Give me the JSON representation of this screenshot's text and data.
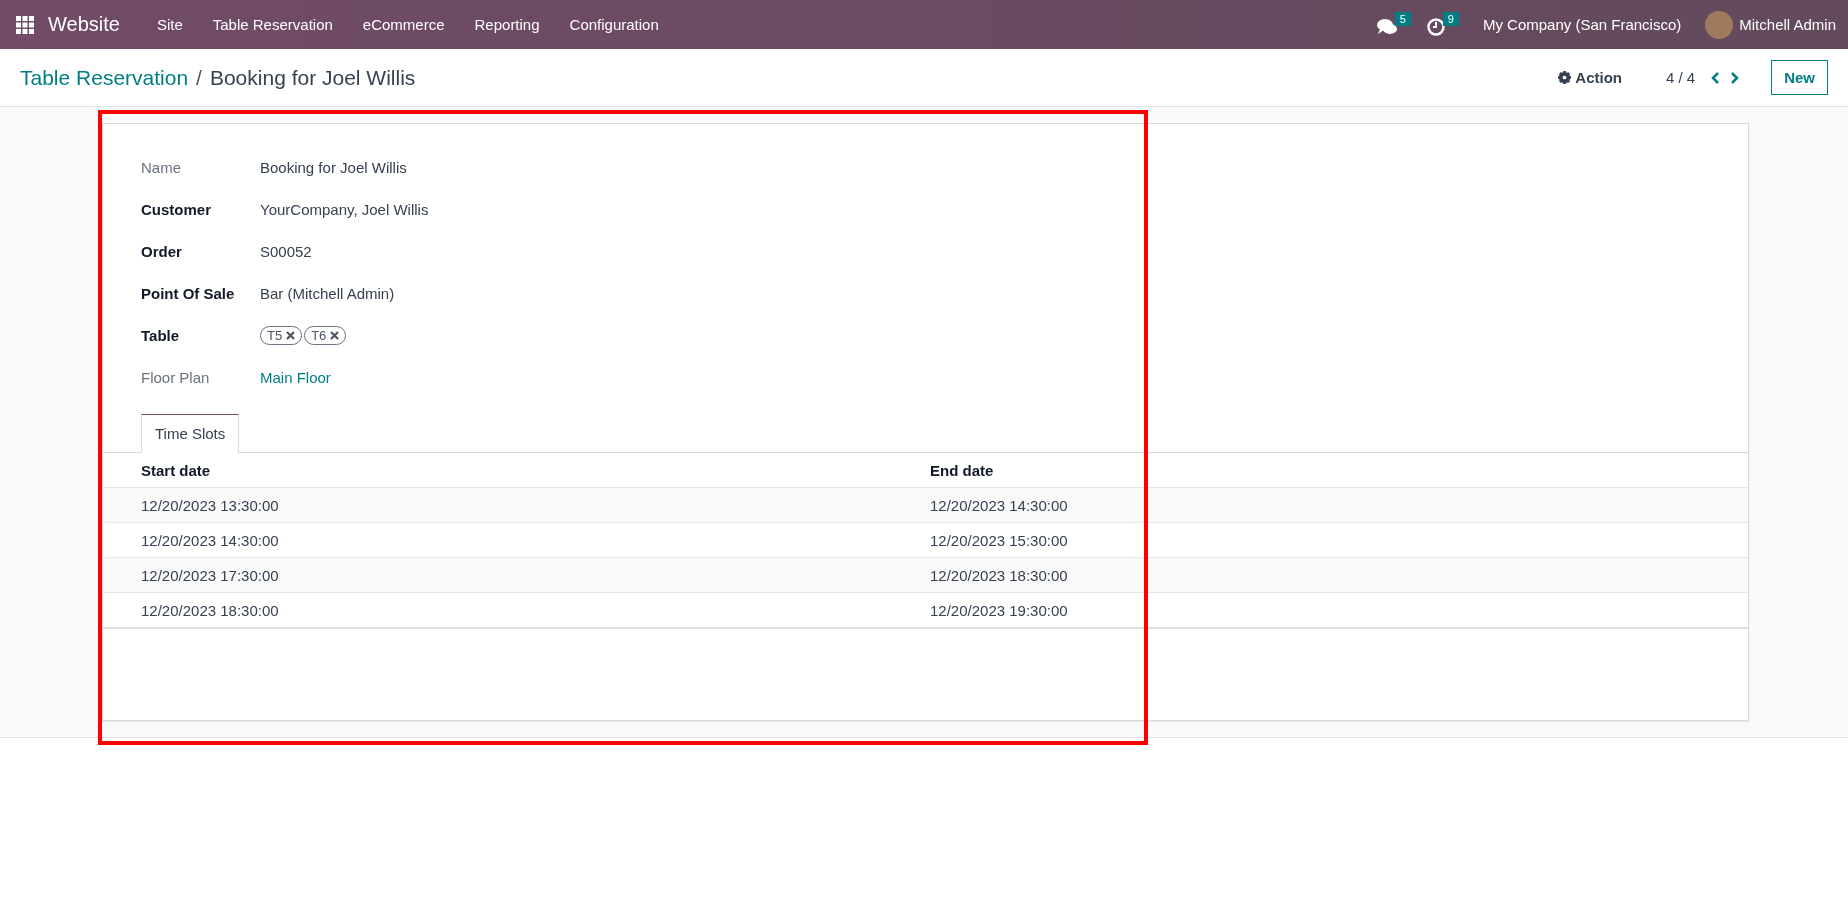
{
  "navbar": {
    "app_name": "Website",
    "menu": [
      "Site",
      "Table Reservation",
      "eCommerce",
      "Reporting",
      "Configuration"
    ],
    "messages_badge": "5",
    "activities_badge": "9",
    "company": "My Company (San Francisco)",
    "user": "Mitchell Admin"
  },
  "breadcrumb": {
    "parent": "Table Reservation",
    "separator": "/",
    "current": "Booking for Joel Willis"
  },
  "control_panel": {
    "action": "Action",
    "pager": "4 / 4",
    "new_button": "New"
  },
  "fields": [
    {
      "label": "Name",
      "kind": "text",
      "required": false,
      "value": "Booking for Joel Willis"
    },
    {
      "label": "Customer",
      "kind": "text",
      "required": true,
      "value": "YourCompany, Joel Willis"
    },
    {
      "label": "Order",
      "kind": "text",
      "required": true,
      "value": "S00052"
    },
    {
      "label": "Point Of Sale",
      "kind": "text",
      "required": true,
      "value": "Bar (Mitchell Admin)"
    },
    {
      "label": "Table",
      "kind": "tags",
      "required": true,
      "tags": [
        "T5",
        "T6"
      ]
    },
    {
      "label": "Floor Plan",
      "kind": "link",
      "required": false,
      "value": "Main Floor"
    }
  ],
  "tabs": [
    {
      "label": "Time Slots",
      "selected": true
    }
  ],
  "table": {
    "columns": [
      "Start date",
      "End date"
    ],
    "rows": [
      [
        "12/20/2023 13:30:00",
        "12/20/2023 14:30:00"
      ],
      [
        "12/20/2023 14:30:00",
        "12/20/2023 15:30:00"
      ],
      [
        "12/20/2023 17:30:00",
        "12/20/2023 18:30:00"
      ],
      [
        "12/20/2023 18:30:00",
        "12/20/2023 19:30:00"
      ]
    ]
  }
}
